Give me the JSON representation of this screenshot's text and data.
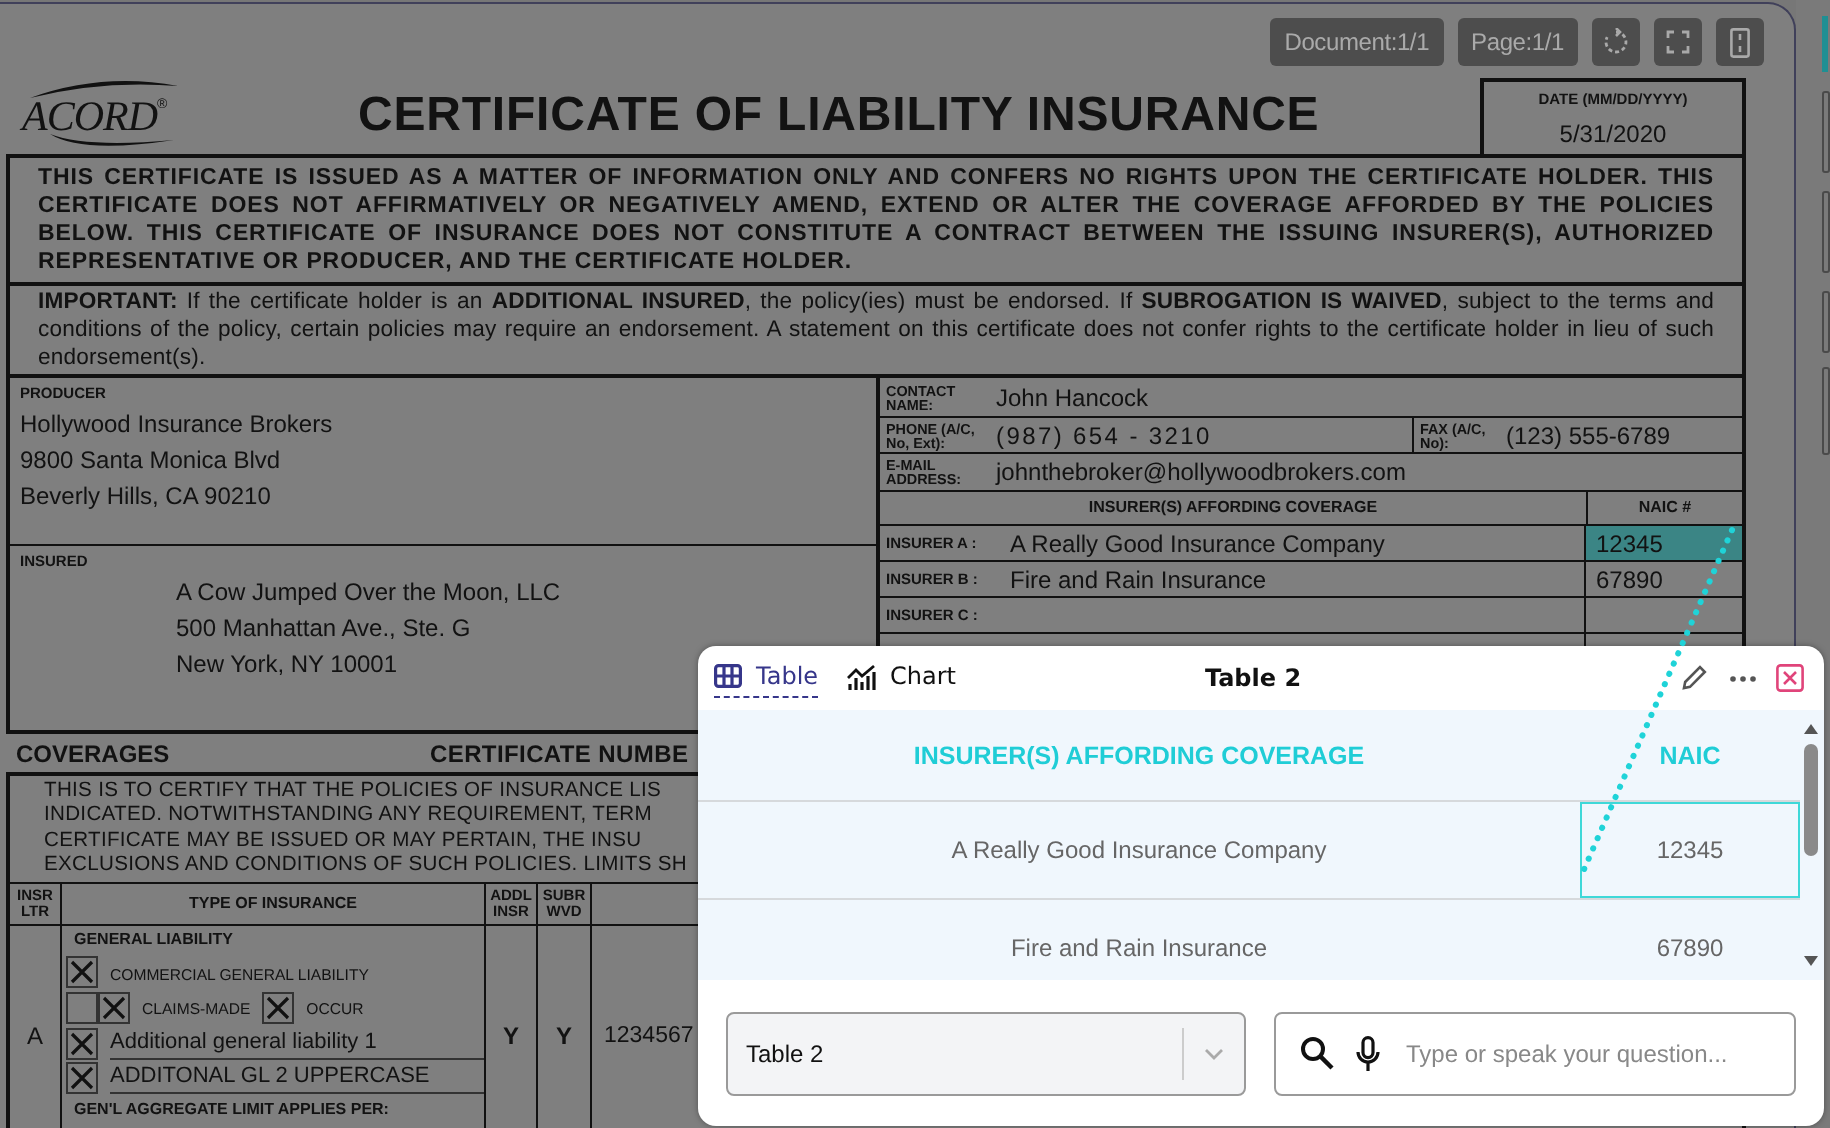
{
  "viewer": {
    "toolbar": [
      {
        "kind": "counter",
        "text": "Document:1/1"
      },
      {
        "kind": "counter",
        "text": "Page:1/1"
      },
      {
        "kind": "rotate"
      },
      {
        "kind": "fullscreen"
      },
      {
        "kind": "page"
      }
    ]
  },
  "document": {
    "logo": "ACORD",
    "logo_mark": "®",
    "title": "CERTIFICATE OF LIABILITY INSURANCE",
    "date_label": "DATE (MM/DD/YYYY)",
    "date": "5/31/2020",
    "notice": "THIS CERTIFICATE IS ISSUED AS A MATTER OF INFORMATION ONLY AND CONFERS NO RIGHTS UPON THE CERTIFICATE HOLDER. THIS CERTIFICATE DOES NOT AFFIRMATIVELY OR NEGATIVELY AMEND, EXTEND OR ALTER THE COVERAGE AFFORDED BY THE POLICIES BELOW. THIS CERTIFICATE OF INSURANCE DOES NOT CONSTITUTE A CONTRACT BETWEEN THE ISSUING INSURER(S), AUTHORIZED REPRESENTATIVE OR PRODUCER, AND THE CERTIFICATE HOLDER.",
    "important": "**IMPORTANT:** If the certificate holder is an **ADDITIONAL INSURED**, the policy(ies) must be endorsed. If **SUBROGATION IS WAIVED**, subject to the terms and conditions of the policy, certain policies may require an endorsement. A statement on this certificate does not confer rights to the certificate holder in lieu of such endorsement(s).",
    "producer": {
      "label": "PRODUCER",
      "lines": [
        "Hollywood Insurance Brokers",
        "9800 Santa Monica Blvd",
        "Beverly Hills, CA 90210"
      ]
    },
    "insured": {
      "label": "INSURED",
      "lines": [
        "A Cow Jumped Over the Moon, LLC",
        "500 Manhattan Ave., Ste. G",
        "New York, NY 10001"
      ]
    },
    "contact": {
      "name_label": "CONTACT NAME:",
      "name": "John Hancock",
      "phone_label": "PHONE (A/C, No, Ext):",
      "phone": "(987) 654 - 3210",
      "fax_label": "FAX (A/C, No):",
      "fax": "(123) 555-6789",
      "email_label": "E-MAIL ADDRESS:",
      "email": "johnthebroker@hollywoodbrokers.com"
    },
    "insurers": {
      "header": "INSURER(S) AFFORDING COVERAGE",
      "naic_header": "NAIC #",
      "rows": [
        {
          "label": "INSURER A :",
          "name": "A Really Good Insurance Company",
          "naic": "12345",
          "highlighted": true
        },
        {
          "label": "INSURER B :",
          "name": "Fire and Rain Insurance",
          "naic": "67890",
          "highlighted": false
        },
        {
          "label": "INSURER C :",
          "highlighted": false
        }
      ]
    },
    "coverages": {
      "heading": "COVERAGES",
      "certificate_number": "CERTIFICATE NUMBE",
      "notice_lines": [
        "THIS IS TO CERTIFY THAT THE POLICIES OF INSURANCE LIS",
        "INDICATED. NOTWITHSTANDING ANY REQUIREMENT, TERM",
        "CERTIFICATE MAY BE ISSUED OR MAY PERTAIN, THE INSU",
        "EXCLUSIONS AND CONDITIONS OF SUCH POLICIES. LIMITS SH"
      ],
      "columns": [
        "INSR LTR",
        "TYPE OF INSURANCE",
        "ADDL INSR",
        "SUBR WVD"
      ],
      "row": {
        "letter": "A",
        "section": "GENERAL LIABILITY",
        "addl": "Y",
        "subr": "Y",
        "policy": "1234567",
        "aggregate": "GEN'L AGGREGATE LIMIT APPLIES PER:",
        "items": [
          {
            "kind": "option",
            "checked": true,
            "label": "COMMERCIAL GENERAL LIABILITY"
          },
          {
            "kind": "pair",
            "checked": false,
            "options": [
              {
                "checked": true,
                "label": "CLAIMS-MADE"
              },
              {
                "checked": true,
                "label": "OCCUR"
              }
            ]
          },
          {
            "kind": "entry",
            "checked": true,
            "label": "Additional general liability 1"
          },
          {
            "kind": "entry",
            "checked": true,
            "label": "ADDITONAL GL 2 UPPERCASE"
          }
        ]
      }
    }
  },
  "panel": {
    "tabs": [
      {
        "label": "Table",
        "kind": "table",
        "selected": true
      },
      {
        "label": "Chart",
        "kind": "chart",
        "selected": false
      }
    ],
    "title": "Table 2",
    "table": {
      "columns": [
        "INSURER(S) AFFORDING COVERAGE",
        "NAIC"
      ],
      "rows": [
        {
          "cells": [
            {
              "text": "A Really Good Insurance Company",
              "selected": false
            },
            {
              "text": "12345",
              "selected": true
            }
          ]
        },
        {
          "cells": [
            {
              "text": "Fire and Rain Insurance",
              "selected": false
            },
            {
              "text": "67890",
              "selected": false
            }
          ]
        }
      ]
    },
    "table_select": {
      "value": "Table 2"
    },
    "question": {
      "placeholder": "Type or speak your question..."
    }
  }
}
